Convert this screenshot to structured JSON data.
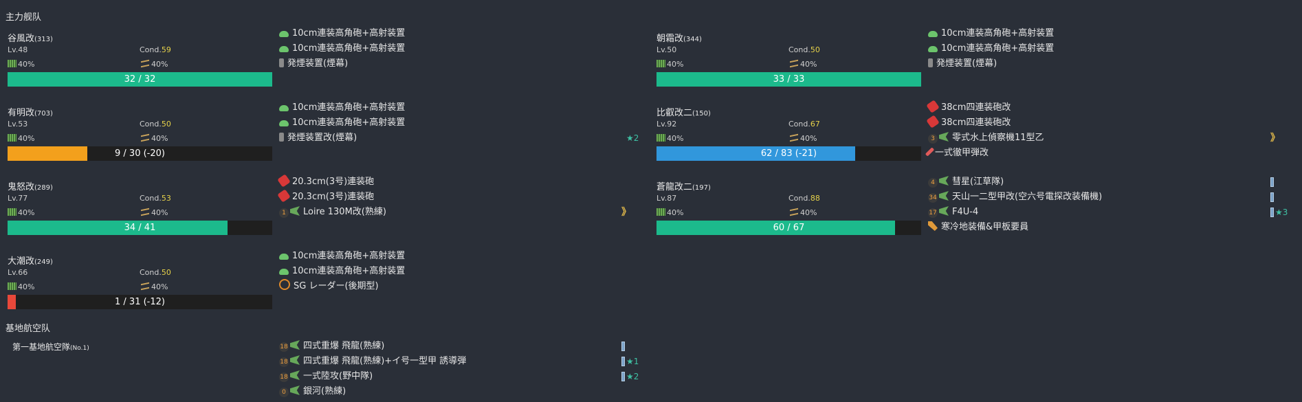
{
  "sections": {
    "main_fleet": "主力舰队",
    "base_air": "基地航空队"
  },
  "fleet": [
    {
      "name": "谷風改",
      "id": "(313)",
      "lv": "Lv.48",
      "cond_label": "Cond.",
      "cond": "59",
      "fuel": "40%",
      "ammo": "40%",
      "hp_text": "32 / 32",
      "hp_fraction": 1.0,
      "hp_color": "#1cba8c",
      "equip": [
        {
          "icon": "high-angle-gun-icon",
          "name": "10cm連装高角砲+高射装置"
        },
        {
          "icon": "high-angle-gun-icon",
          "name": "10cm連装高角砲+高射装置"
        },
        {
          "icon": "smoke-generator-icon",
          "name": "発煙装置(煙幕)"
        }
      ]
    },
    {
      "name": "有明改",
      "id": "(703)",
      "lv": "Lv.53",
      "cond_label": "Cond.",
      "cond": "50",
      "fuel": "40%",
      "ammo": "40%",
      "hp_text": "9 / 30 (-20)",
      "hp_fraction": 0.3,
      "hp_color": "#f3a01c",
      "equip": [
        {
          "icon": "high-angle-gun-icon",
          "name": "10cm連装高角砲+高射装置"
        },
        {
          "icon": "high-angle-gun-icon",
          "name": "10cm連装高角砲+高射装置"
        },
        {
          "icon": "smoke-generator-icon",
          "name": "発煙装置改(煙幕)",
          "star": "★2"
        }
      ]
    },
    {
      "name": "鬼怒改",
      "id": "(289)",
      "lv": "Lv.77",
      "cond_label": "Cond.",
      "cond": "53",
      "fuel": "40%",
      "ammo": "40%",
      "hp_text": "34 / 41",
      "hp_fraction": 0.83,
      "hp_color": "#1cba8c",
      "equip": [
        {
          "icon": "main-gun-icon",
          "name": "20.3cm(3号)連装砲"
        },
        {
          "icon": "main-gun-icon",
          "name": "20.3cm(3号)連装砲"
        },
        {
          "icon": "seaplane-icon",
          "name": "Loire 130M改(熟練)",
          "slot": "1",
          "prof": "》"
        }
      ]
    },
    {
      "name": "大潮改",
      "id": "(249)",
      "lv": "Lv.66",
      "cond_label": "Cond.",
      "cond": "50",
      "fuel": "40%",
      "ammo": "40%",
      "hp_text": "1 / 31 (-12)",
      "hp_fraction": 0.03,
      "hp_color": "#e8483a",
      "equip": [
        {
          "icon": "high-angle-gun-icon",
          "name": "10cm連装高角砲+高射装置"
        },
        {
          "icon": "high-angle-gun-icon",
          "name": "10cm連装高角砲+高射装置"
        },
        {
          "icon": "radar-icon",
          "name": "SG レーダー(後期型)"
        }
      ]
    },
    {
      "name": "朝霜改",
      "id": "(344)",
      "lv": "Lv.50",
      "cond_label": "Cond.",
      "cond": "50",
      "fuel": "40%",
      "ammo": "40%",
      "hp_text": "33 / 33",
      "hp_fraction": 1.0,
      "hp_color": "#1cba8c",
      "equip": [
        {
          "icon": "high-angle-gun-icon",
          "name": "10cm連装高角砲+高射装置"
        },
        {
          "icon": "high-angle-gun-icon",
          "name": "10cm連装高角砲+高射装置"
        },
        {
          "icon": "smoke-generator-icon",
          "name": "発煙装置(煙幕)"
        }
      ]
    },
    {
      "name": "比叡改二",
      "id": "(150)",
      "lv": "Lv.92",
      "cond_label": "Cond.",
      "cond": "67",
      "fuel": "40%",
      "ammo": "40%",
      "hp_text": "62 / 83 (-21)",
      "hp_fraction": 0.75,
      "hp_color": "#3197dc",
      "equip": [
        {
          "icon": "main-gun-icon",
          "name": "38cm四連装砲改"
        },
        {
          "icon": "main-gun-icon",
          "name": "38cm四連装砲改"
        },
        {
          "icon": "seaplane-icon",
          "name": "零式水上偵察機11型乙",
          "slot": "3",
          "prof": "》"
        },
        {
          "icon": "ap-shell-icon",
          "name": "一式徹甲弾改"
        }
      ]
    },
    {
      "name": "蒼龍改二",
      "id": "(197)",
      "lv": "Lv.87",
      "cond_label": "Cond.",
      "cond": "88",
      "fuel": "40%",
      "ammo": "40%",
      "hp_text": "60 / 67",
      "hp_fraction": 0.9,
      "hp_color": "#1cba8c",
      "equip": [
        {
          "icon": "dive-bomber-icon",
          "name": "彗星(江草隊)",
          "slot": "4",
          "bar": true
        },
        {
          "icon": "torpedo-bomber-icon",
          "name": "天山一二型甲改(空六号電探改装備機)",
          "slot": "34",
          "bar": true
        },
        {
          "icon": "fighter-icon",
          "name": "F4U-4",
          "slot": "17",
          "bar": true,
          "star": "★3"
        },
        {
          "icon": "wrench-icon",
          "name": "寒冷地装備&甲板要員"
        }
      ]
    }
  ],
  "base": {
    "name": "第一基地航空隊",
    "id": "(No.1)",
    "equip": [
      {
        "icon": "heavy-bomber-icon",
        "name": "四式重爆 飛龍(熟練)",
        "slot": "18",
        "bar": true
      },
      {
        "icon": "heavy-bomber-icon",
        "name": "四式重爆 飛龍(熟練)+イ号一型甲 誘導弾",
        "slot": "18",
        "bar": true,
        "star": "★1"
      },
      {
        "icon": "land-attacker-icon",
        "name": "一式陸攻(野中隊)",
        "slot": "18",
        "bar": true,
        "star": "★2"
      },
      {
        "icon": "land-attacker-icon",
        "name": "銀河(熟練)",
        "slot": "0"
      }
    ]
  }
}
